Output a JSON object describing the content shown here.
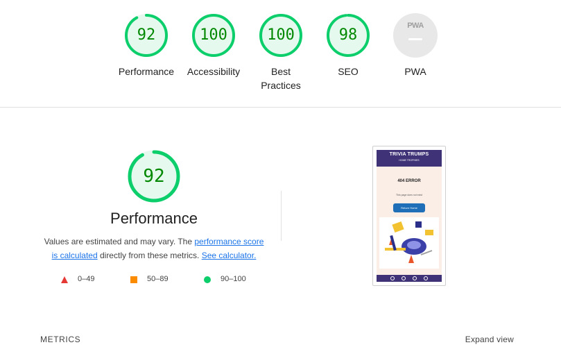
{
  "scores": [
    {
      "id": "performance",
      "value": "92",
      "label": "Performance",
      "fraction": 0.92
    },
    {
      "id": "accessibility",
      "value": "100",
      "label": "Accessibility",
      "fraction": 1.0
    },
    {
      "id": "best-practices",
      "value": "100",
      "label": "Best Practices",
      "fraction": 1.0
    },
    {
      "id": "seo",
      "value": "98",
      "label": "SEO",
      "fraction": 0.98
    }
  ],
  "pwa": {
    "badge_text": "PWA",
    "label": "PWA"
  },
  "performance_section": {
    "score": "92",
    "fraction": 0.92,
    "title": "Performance",
    "desc_prefix": "Values are estimated and may vary. The ",
    "link_score_calc": "performance score is calculated",
    "desc_middle": " directly from these metrics. ",
    "link_calculator": "See calculator."
  },
  "legend": [
    {
      "shape": "triangle",
      "range": "0–49",
      "color": "#e53935"
    },
    {
      "shape": "square",
      "range": "50–89",
      "color": "#fb8c00"
    },
    {
      "shape": "circle",
      "range": "90–100",
      "color": "#0cce6b"
    }
  ],
  "screenshot": {
    "brand": "TRIVIA TRUMPS",
    "nav": "HOME    TROPHIES",
    "error_title": "404 ERROR",
    "error_text": "This page does not exist",
    "button": "Return Home"
  },
  "metrics": {
    "heading": "METRICS",
    "expand": "Expand view"
  },
  "colors": {
    "pass_ring": "#0cce6b",
    "pass_fill": "#e6f9ee",
    "pass_text": "#008800",
    "pwa_gray": "#e8e8e8",
    "link": "#1a73e8"
  }
}
